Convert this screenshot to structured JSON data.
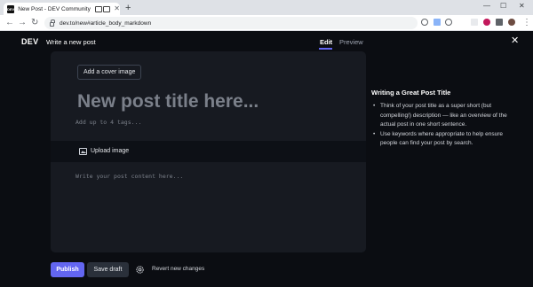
{
  "browser": {
    "tab_title": "New Post - DEV Community",
    "tab_favicon_text": "DEV",
    "tab_close": "✕",
    "new_tab": "+",
    "window": {
      "minimize": "—",
      "maximize": "☐",
      "close": "✕"
    },
    "url": "dev.to/new#article_body_markdown",
    "nav": {
      "back": "←",
      "forward": "→",
      "reload": "↻"
    }
  },
  "header": {
    "logo": "DEV",
    "page_title": "Write a new post",
    "tabs": [
      {
        "label": "Edit",
        "active": true
      },
      {
        "label": "Preview",
        "active": false
      }
    ],
    "close": "✕"
  },
  "editor": {
    "cover_button": "Add a cover image",
    "title_placeholder": "New post title here...",
    "tags_placeholder": "Add up to 4 tags...",
    "upload_image": "Upload image",
    "body_placeholder": "Write your post content here..."
  },
  "guide": {
    "title": "Writing a Great Post Title",
    "items": [
      "Think of your post title as a super short (but compelling!) description — like an overview of the actual post in one short sentence.",
      "Use keywords where appropriate to help ensure people can find your post by search."
    ]
  },
  "actions": {
    "publish": "Publish",
    "save_draft": "Save draft",
    "revert": "Revert new changes"
  },
  "colors": {
    "accent": "#6366f1",
    "background": "#0b0d12",
    "card": "#171a21"
  }
}
